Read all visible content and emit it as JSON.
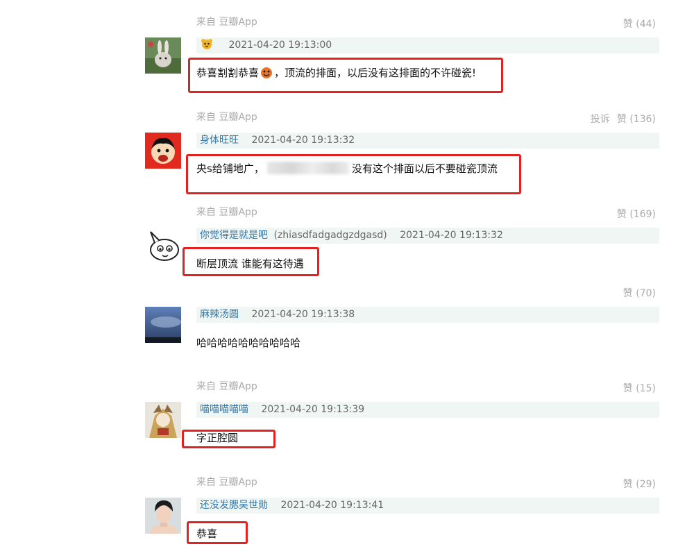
{
  "comments": [
    {
      "source": "来自 豆瓣App",
      "report": "",
      "likes": "赞 (44)",
      "user": "",
      "uid": "",
      "time": "2021-04-20 19:13:00",
      "text_before": "恭喜割割恭喜",
      "text_after": "，顶流的排面，以后没有这排面的不许碰瓷!"
    },
    {
      "source": "来自 豆瓣App",
      "report": "投诉",
      "likes": "赞 (136)",
      "user": "身体旺旺",
      "uid": "",
      "time": "2021-04-20 19:13:32",
      "text_before": "央s给铺地广，",
      "text_after": "没有这个排面以后不要碰瓷顶流"
    },
    {
      "source": "来自 豆瓣App",
      "report": "",
      "likes": "赞 (169)",
      "user": "你觉得是就是吧",
      "uid": "(zhiasdfadgadgzdgasd)",
      "time": "2021-04-20 19:13:32",
      "text": "断层顶流 谁能有这待遇"
    },
    {
      "source": "",
      "report": "",
      "likes": "赞 (70)",
      "user": "麻辣汤圆",
      "uid": "",
      "time": "2021-04-20 19:13:38",
      "text": "哈哈哈哈哈哈哈哈哈哈"
    },
    {
      "source": "来自 豆瓣App",
      "report": "",
      "likes": "赞 (15)",
      "user": "喵喵喵喵喵",
      "uid": "",
      "time": "2021-04-20 19:13:39",
      "text": "字正腔圆"
    },
    {
      "source": "来自 豆瓣App",
      "report": "",
      "likes": "赞 (29)",
      "user": "还没发腮吴世勋",
      "uid": "",
      "time": "2021-04-20 19:13:41",
      "text": "恭喜"
    }
  ],
  "colors": {
    "username": "#3377aa",
    "meta_bg": "#f0f6f3",
    "highlight_box": "#e52020",
    "muted": "#aaaaaa"
  },
  "icons": [
    "bear-emoji-icon",
    "face-emoji-icon"
  ]
}
